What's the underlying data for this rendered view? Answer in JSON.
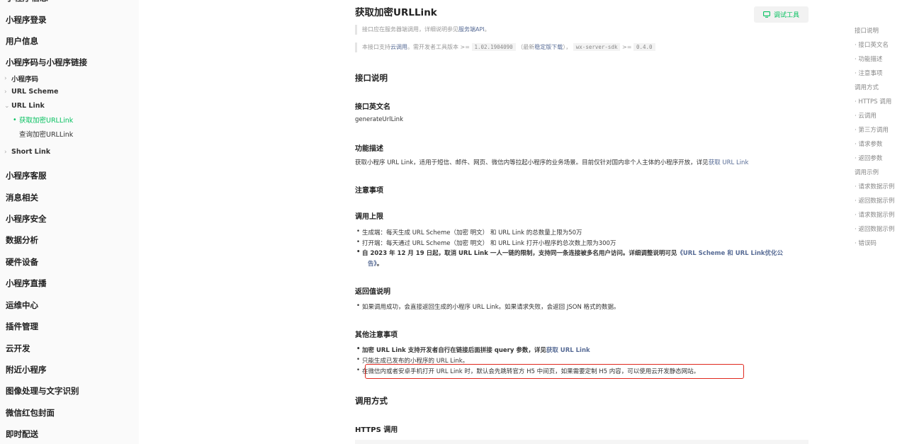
{
  "sidebar": {
    "top_partial": "小程序信息",
    "items": [
      {
        "label": "小程序登录"
      },
      {
        "label": "用户信息"
      },
      {
        "label": "小程序码与小程序链接"
      },
      {
        "label": "小程序码",
        "level": 2,
        "chevron": "right"
      },
      {
        "label": "URL Scheme",
        "level": 2,
        "chevron": "right"
      },
      {
        "label": "URL Link",
        "level": 2,
        "chevron": "down"
      },
      {
        "label": "获取加密URLLink",
        "level": 3,
        "active": true
      },
      {
        "label": "查询加密URLLink",
        "level": 3
      },
      {
        "label": "Short Link",
        "level": 2,
        "chevron": "right"
      },
      {
        "label": "小程序客服"
      },
      {
        "label": "消息相关"
      },
      {
        "label": "小程序安全"
      },
      {
        "label": "数据分析"
      },
      {
        "label": "硬件设备"
      },
      {
        "label": "小程序直播"
      },
      {
        "label": "运维中心"
      },
      {
        "label": "插件管理"
      },
      {
        "label": "云开发"
      },
      {
        "label": "附近小程序"
      },
      {
        "label": "图像处理与文字识别"
      },
      {
        "label": "微信红包封面"
      },
      {
        "label": "即时配送"
      }
    ]
  },
  "main": {
    "title": "获取加密URLLink",
    "debug_button": "调试工具",
    "note1": {
      "text": "接口应在服务器端调用，详细说明参见",
      "link": "服务端API",
      "tail": "。"
    },
    "note2": {
      "a": "本接口支持",
      "link1": "云调用",
      "b": "。需开发者工具版本 >=",
      "code1": "1.02.1904090",
      "c": "（最新",
      "link2": "稳定版下载",
      "d": "），",
      "code2": "wx-server-sdk",
      "e": ">=",
      "code3": "0.4.0"
    },
    "sec_api": "接口说明",
    "sec_name": "接口英文名",
    "api_name": "generateUrlLink",
    "sec_desc": "功能描述",
    "desc_text": "获取小程序 URL Link，适用于短信、邮件、网页、微信内等拉起小程序的业务场景。目前仅针对国内非个人主体的小程序开放，详见",
    "desc_link": "获取 URL Link",
    "sec_notes": "注意事项",
    "sec_limit": "调用上限",
    "limit_bullets": [
      "生成端：每天生成 URL Scheme（加密 明文） 和 URL Link 的总数量上限为50万",
      "打开端：每天通过 URL Scheme（加密 明文） 和 URL Link 打开小程序的总次数上限为300万"
    ],
    "limit_bold": "自 2023 年 12 月 19 日起，取消 URL Link 一人一链的限制，支持同一条连接被多名用户访问。详细调整说明可见",
    "limit_bold_link": "《URL Scheme 和 URL Link优化公",
    "limit_bold_link2": "告》",
    "limit_bold_tail": "。",
    "sec_return": "返回值说明",
    "return_bullet": "如果调用成功，会直接返回生成的小程序 URL Link。如果请求失败，会返回 JSON 格式的数据。",
    "sec_other": "其他注意事项",
    "other_bullet1": "加密 URL Link 支持开发者自行在链接后面拼接 query 参数，详见",
    "other_bullet1_link": "获取 URL Link",
    "other_bullet2": "只能生成已发布的小程序的 URL Link。",
    "other_bullet3": "在微信内或者安卓手机打开 URL Link 时，默认会先跳转官方 H5 中间页，如果需要定制 H5 内容，可以使用云开发静态网站。",
    "sec_call": "调用方式",
    "sec_https": "HTTPS 调用"
  },
  "toc": [
    "接口说明",
    "· 接口英文名",
    "· 功能描述",
    "· 注意事项",
    "调用方式",
    "· HTTPS 调用",
    "· 云调用",
    "· 第三方调用",
    "· 请求参数",
    "· 返回参数",
    "调用示例",
    "· 请求数据示例",
    "· 返回数据示例",
    "· 请求数据示例",
    "· 返回数据示例",
    "· 错误码"
  ],
  "colors": {
    "accent": "#07c160",
    "link": "#576b95",
    "highlight": "#e0281e"
  }
}
